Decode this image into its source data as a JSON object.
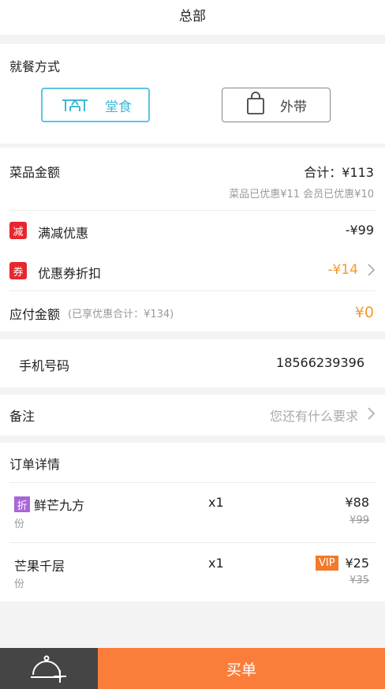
{
  "header": {
    "title": "总部"
  },
  "dining": {
    "label": "就餐方式",
    "options": [
      {
        "label": "堂食",
        "icon": "table-icon",
        "selected": true
      },
      {
        "label": "外带",
        "icon": "bag-icon",
        "selected": false
      }
    ]
  },
  "amount": {
    "label": "菜品金额",
    "total": "合计：¥113",
    "discount_summary": "菜品已优惠¥11  会员已优惠¥10",
    "full_reduction": {
      "badge": "减",
      "label": "满减优惠",
      "value": "-¥99"
    },
    "coupon": {
      "badge": "券",
      "label": "优惠券折扣",
      "value": "-¥14"
    },
    "payable": {
      "label": "应付金额",
      "note": "(已享优惠合计：¥134)",
      "value": "¥0"
    }
  },
  "phone": {
    "label": "手机号码",
    "value": "18566239396"
  },
  "note": {
    "label": "备注",
    "placeholder": "您还有什么要求"
  },
  "orders": {
    "label": "订单详情",
    "items": [
      {
        "badge": "折",
        "name": "鲜芒九方",
        "unit": "份",
        "qty": "x1",
        "price": "¥88",
        "original": "¥99",
        "vip": ""
      },
      {
        "badge": "",
        "name": "芒果千层",
        "unit": "份",
        "qty": "x1",
        "price": "¥25",
        "original": "¥35",
        "vip": "VIP"
      }
    ]
  },
  "footer": {
    "checkout_label": "买单",
    "service_icon": "service-bell-icon"
  },
  "colors": {
    "accent": "#3fb8d6",
    "orange": "#fb7d3a",
    "red": "#e8262d",
    "price_orange": "#f39a2c"
  }
}
